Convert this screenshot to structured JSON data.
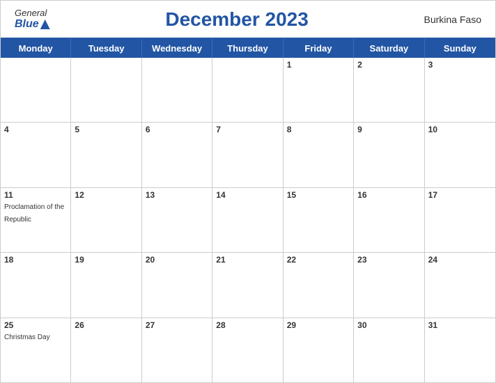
{
  "header": {
    "logo_general": "General",
    "logo_blue": "Blue",
    "title": "December 2023",
    "country": "Burkina Faso"
  },
  "day_headers": [
    "Monday",
    "Tuesday",
    "Wednesday",
    "Thursday",
    "Friday",
    "Saturday",
    "Sunday"
  ],
  "weeks": [
    [
      {
        "day": "",
        "event": ""
      },
      {
        "day": "",
        "event": ""
      },
      {
        "day": "",
        "event": ""
      },
      {
        "day": "",
        "event": ""
      },
      {
        "day": "1",
        "event": ""
      },
      {
        "day": "2",
        "event": ""
      },
      {
        "day": "3",
        "event": ""
      }
    ],
    [
      {
        "day": "4",
        "event": ""
      },
      {
        "day": "5",
        "event": ""
      },
      {
        "day": "6",
        "event": ""
      },
      {
        "day": "7",
        "event": ""
      },
      {
        "day": "8",
        "event": ""
      },
      {
        "day": "9",
        "event": ""
      },
      {
        "day": "10",
        "event": ""
      }
    ],
    [
      {
        "day": "11",
        "event": "Proclamation of the Republic"
      },
      {
        "day": "12",
        "event": ""
      },
      {
        "day": "13",
        "event": ""
      },
      {
        "day": "14",
        "event": ""
      },
      {
        "day": "15",
        "event": ""
      },
      {
        "day": "16",
        "event": ""
      },
      {
        "day": "17",
        "event": ""
      }
    ],
    [
      {
        "day": "18",
        "event": ""
      },
      {
        "day": "19",
        "event": ""
      },
      {
        "day": "20",
        "event": ""
      },
      {
        "day": "21",
        "event": ""
      },
      {
        "day": "22",
        "event": ""
      },
      {
        "day": "23",
        "event": ""
      },
      {
        "day": "24",
        "event": ""
      }
    ],
    [
      {
        "day": "25",
        "event": "Christmas Day"
      },
      {
        "day": "26",
        "event": ""
      },
      {
        "day": "27",
        "event": ""
      },
      {
        "day": "28",
        "event": ""
      },
      {
        "day": "29",
        "event": ""
      },
      {
        "day": "30",
        "event": ""
      },
      {
        "day": "31",
        "event": ""
      }
    ]
  ],
  "colors": {
    "primary": "#2255a4",
    "header_bg": "#2255a4",
    "header_text": "#ffffff",
    "cell_border": "#cccccc"
  }
}
